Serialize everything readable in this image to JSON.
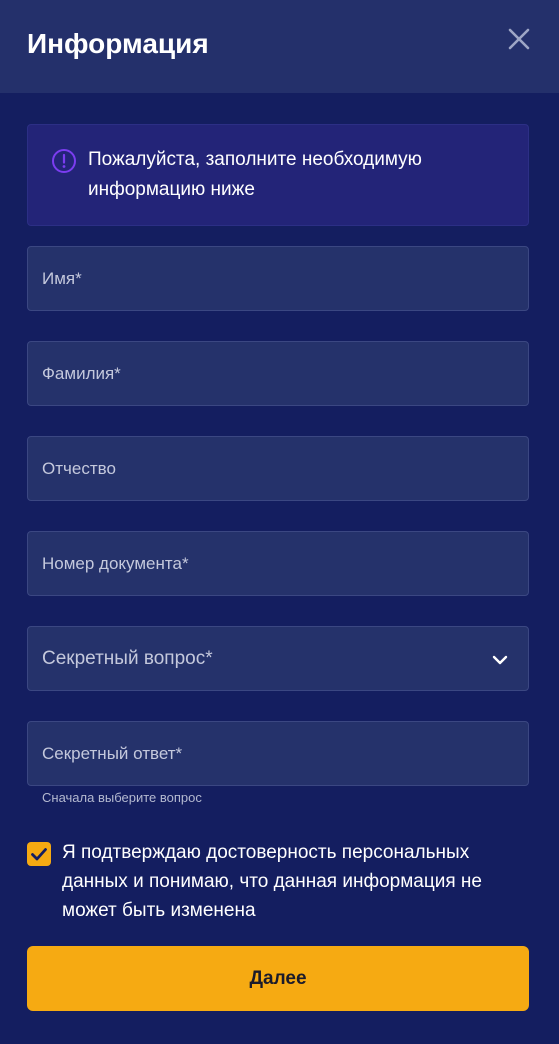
{
  "header": {
    "title": "Информация",
    "close_icon": "close-icon"
  },
  "info": {
    "icon": "exclamation-circle-icon",
    "text": "Пожалуйста, заполните необходимую информацию ниже"
  },
  "form": {
    "first_name": {
      "placeholder": "Имя*",
      "value": ""
    },
    "last_name": {
      "placeholder": "Фамилия*",
      "value": ""
    },
    "middle_name": {
      "placeholder": "Отчество",
      "value": ""
    },
    "document_number": {
      "placeholder": "Номер документа*",
      "value": ""
    },
    "secret_question": {
      "label": "Секретный вопрос*",
      "icon": "chevron-down-icon"
    },
    "secret_answer": {
      "placeholder": "Секретный ответ*",
      "value": "",
      "hint": "Сначала выберите вопрос"
    }
  },
  "consent": {
    "checked": true,
    "text": "Я подтверждаю достоверность персональных данных и понимаю, что данная информация не может быть изменена"
  },
  "submit": {
    "label": "Далее"
  },
  "colors": {
    "background": "#141e60",
    "header": "#24306b",
    "field": "#25326b",
    "info_box": "#232478",
    "accent": "#f6aa12",
    "info_icon": "#7b3df0"
  }
}
